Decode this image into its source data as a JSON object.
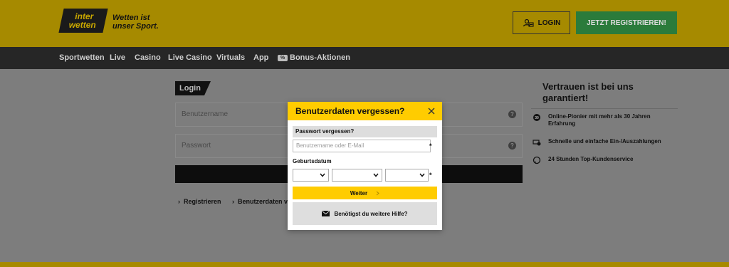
{
  "header": {
    "logo_line1": "inter",
    "logo_line2": "wetten",
    "slogan_line1": "Wetten ist",
    "slogan_line2": "unser Sport.",
    "login_label": "LOGIN",
    "register_label": "JETZT REGISTRIEREN!"
  },
  "nav": {
    "items": [
      "Sportwetten",
      "Live",
      "Casino",
      "Live Casino",
      "Virtuals",
      "App"
    ],
    "promo_icon_text": "%",
    "promo_label": "Bonus-Aktionen"
  },
  "login": {
    "tag": "Login",
    "username_placeholder": "Benutzername",
    "password_placeholder": "Passwort",
    "help_mark": "?",
    "links": [
      "Registrieren",
      "Benutzerdaten ver"
    ]
  },
  "trust": {
    "title": "Vertrauen ist bei uns garantiert!",
    "items": [
      {
        "icon": "award-icon",
        "text": "Online-Pionier mit mehr als 30 Jahren Erfahrung"
      },
      {
        "icon": "payment-icon",
        "text": "Schnelle und einfache Ein-/Auszahlungen"
      },
      {
        "icon": "support-icon",
        "text": "24 Stunden Top-Kundenservice"
      }
    ]
  },
  "modal": {
    "title": "Benutzerdaten vergessen?",
    "section": "Passwort vergessen?",
    "input_placeholder": "Benutzername oder E-Mail",
    "required_mark": "*",
    "dob_label": "Geburtsdatum",
    "next_label": "Weiter",
    "help_label": "Benötigst du weitere Hilfe?"
  },
  "colors": {
    "brand_yellow": "#ffcc00",
    "register_green": "#2b7b3b",
    "nav_bg": "#262626"
  }
}
